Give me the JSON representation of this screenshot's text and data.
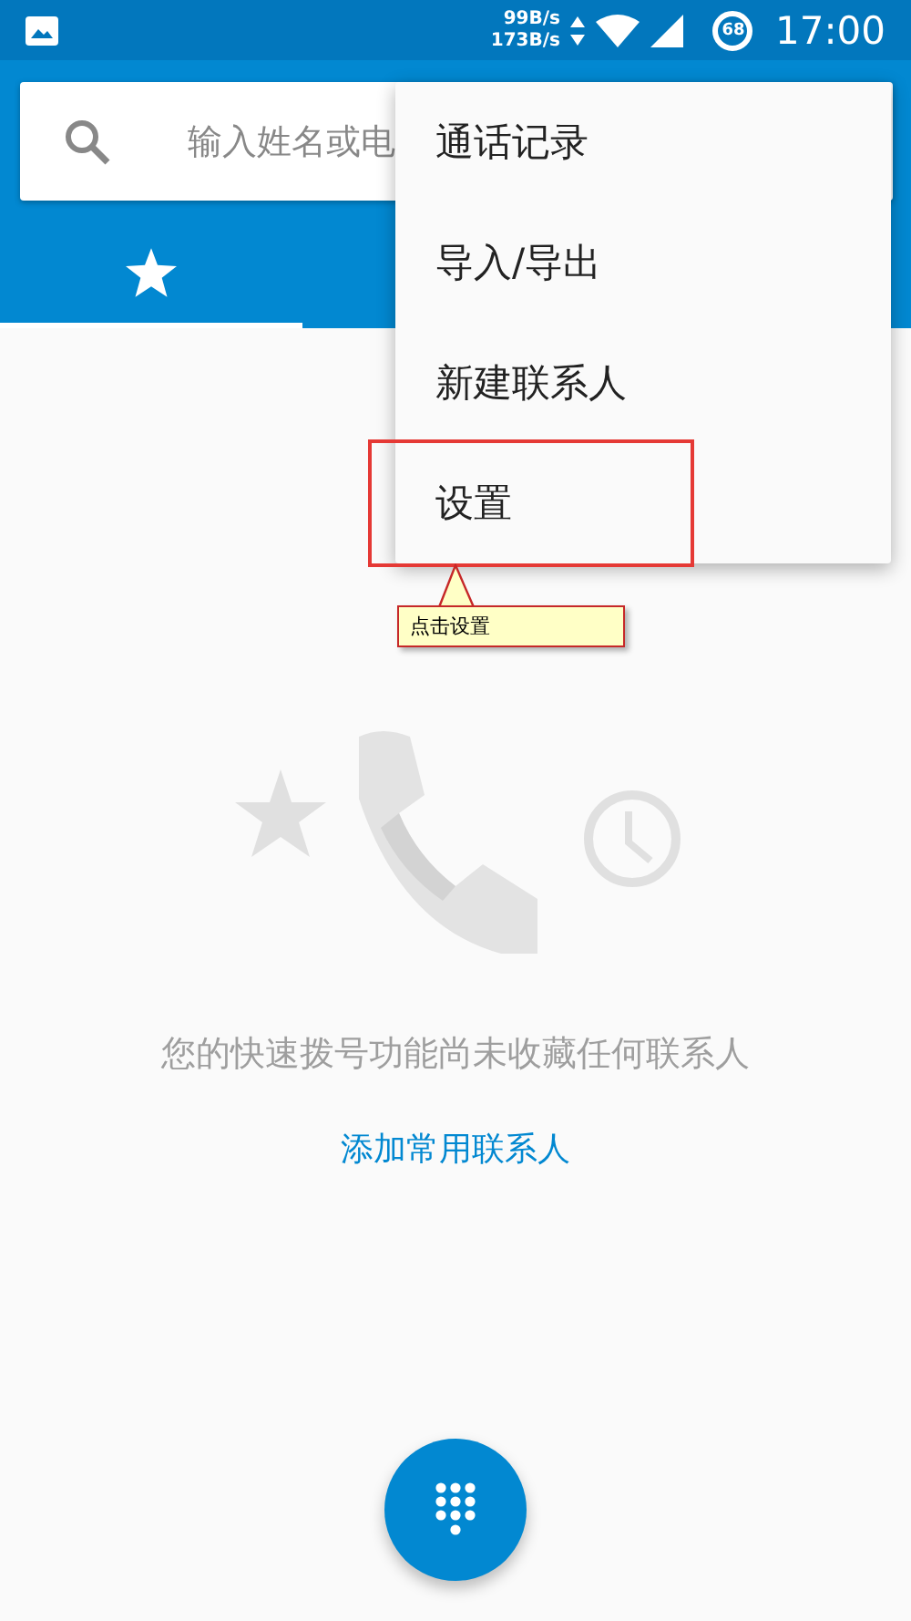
{
  "status_bar": {
    "net_up": "99B/s",
    "net_down": "173B/s",
    "battery": "68",
    "time": "17:00"
  },
  "search": {
    "placeholder": "输入姓名或电"
  },
  "tabs": [
    {
      "kind": "favorites",
      "selected": true
    }
  ],
  "menu": {
    "items": [
      {
        "label": "通话记录",
        "highlighted": false
      },
      {
        "label": "导入/导出",
        "highlighted": false
      },
      {
        "label": "新建联系人",
        "highlighted": false
      },
      {
        "label": "设置",
        "highlighted": true
      }
    ]
  },
  "annotation": {
    "text": "点击设置"
  },
  "empty_state": {
    "message": "您的快速拨号功能尚未收藏任何联系人",
    "link": "添加常用联系人"
  }
}
